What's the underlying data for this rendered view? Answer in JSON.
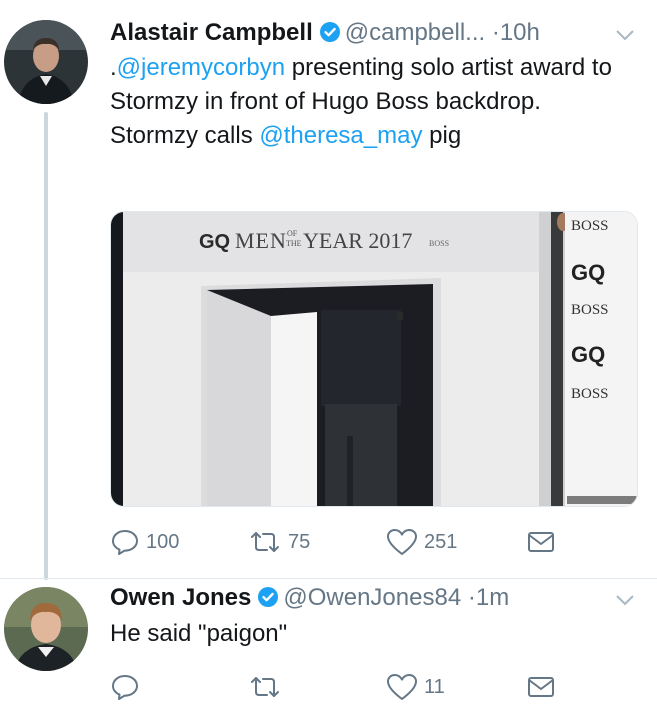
{
  "tweets": [
    {
      "name": "Alastair Campbell",
      "handle": "@campbell...",
      "dot": "·",
      "time": "10h",
      "text": [
        {
          "t": ".",
          "m": false
        },
        {
          "t": "@jeremycorbyn",
          "m": true
        },
        {
          "t": " presenting solo artist award to Stormzy in front of Hugo Boss backdrop. Stormzy calls ",
          "m": false
        },
        {
          "t": "@theresa_may",
          "m": true
        },
        {
          "t": " pig",
          "m": false
        }
      ],
      "media": {
        "sign": "GQ MEN OF THE YEAR 2017",
        "sign_gq": "GQ",
        "sign_main": "MEN",
        "sign_of": "OF",
        "sign_the": "THE",
        "sign_year": "YEAR 2017",
        "sign_boss": "BOSS",
        "panel": [
          "BOSS",
          "GQ",
          "BOSS",
          "GQ",
          "BOSS"
        ]
      },
      "replies": "100",
      "retweets": "75",
      "likes": "251"
    },
    {
      "name": "Owen Jones",
      "handle": "@OwenJones84",
      "dot": "·",
      "time": "1m",
      "text": [
        {
          "t": "He said \"paigon\"",
          "m": false
        }
      ],
      "replies": "",
      "retweets": "",
      "likes": "11"
    }
  ],
  "colors": {
    "accent": "#1da1f2",
    "muted": "#657786",
    "thread": "#ccd6dd"
  },
  "icons": [
    "verified-badge-icon",
    "chevron-down-icon",
    "reply-icon",
    "retweet-icon",
    "like-icon",
    "direct-message-icon"
  ]
}
